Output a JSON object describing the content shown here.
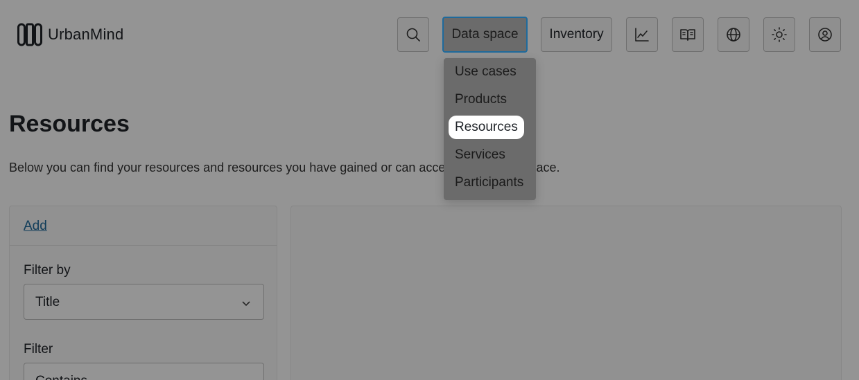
{
  "brand": {
    "name": "UrbanMind",
    "icon": "urbanmind-logo-icon"
  },
  "header": {
    "nav": [
      {
        "key": "search",
        "icon": "search-icon"
      },
      {
        "key": "data_space",
        "label": "Data space"
      },
      {
        "key": "inventory",
        "label": "Inventory"
      },
      {
        "key": "analytics",
        "icon": "chart-icon"
      },
      {
        "key": "docs",
        "icon": "book-icon"
      },
      {
        "key": "language",
        "icon": "globe-icon"
      },
      {
        "key": "theme",
        "icon": "sun-icon"
      },
      {
        "key": "account",
        "icon": "user-circle-icon"
      }
    ]
  },
  "dropdown": {
    "items": [
      "Use cases",
      "Products",
      "Resources",
      "Services",
      "Participants"
    ],
    "selected": "Resources"
  },
  "main": {
    "title": "Resources",
    "description": "Below you can find your resources and resources you have gained or can access in the data space.",
    "add_label": "Add",
    "filter_by_label": "Filter by",
    "filter_by_value": "Title",
    "filter_label": "Filter",
    "filter_value": "Contains"
  },
  "colors": {
    "accent": "#1e6a9c",
    "overlay": "rgba(0,0,0,0.42)"
  }
}
